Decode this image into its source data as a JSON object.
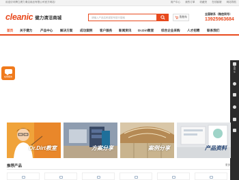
{
  "topbar": {
    "welcome": "欢迎访问腾立健力清洁用品有限公司官方网站!",
    "links": [
      "用户中心",
      "我的订单",
      "收藏夹",
      "在线客服",
      "网站导航"
    ]
  },
  "header": {
    "logo_text": "cleanic",
    "logo_subtitle": "健力清洁商城",
    "search_placeholder": "请输入产品名称或型号进行搜索",
    "cart_label": "购物车",
    "hotline_label": "全国联系（微信同号）",
    "hotline_number": "13925963684"
  },
  "nav": {
    "items": [
      "首页",
      "关于健力",
      "产品中心",
      "解决方案",
      "成功案例",
      "客户服务",
      "新闻资讯",
      "Dr.Dirt教室",
      "综合企业采购",
      "人才招聘",
      "联系我们"
    ],
    "active_index": 0
  },
  "widget": {
    "message_label": "在线留言"
  },
  "sidebar": {
    "items": [
      "购物车",
      "收藏",
      "客服",
      "足迹"
    ]
  },
  "tiles": [
    {
      "label": "Dr.Dirt教室"
    },
    {
      "label": "方案分享"
    },
    {
      "label": "案例分享"
    },
    {
      "label": "产品资料"
    }
  ],
  "recommend": {
    "title": "推荐产品",
    "more": "更多"
  },
  "colors": {
    "brand": "#e8491d",
    "accent_orange": "#f07a1c",
    "sidebar_bg": "#2b2b2b"
  }
}
